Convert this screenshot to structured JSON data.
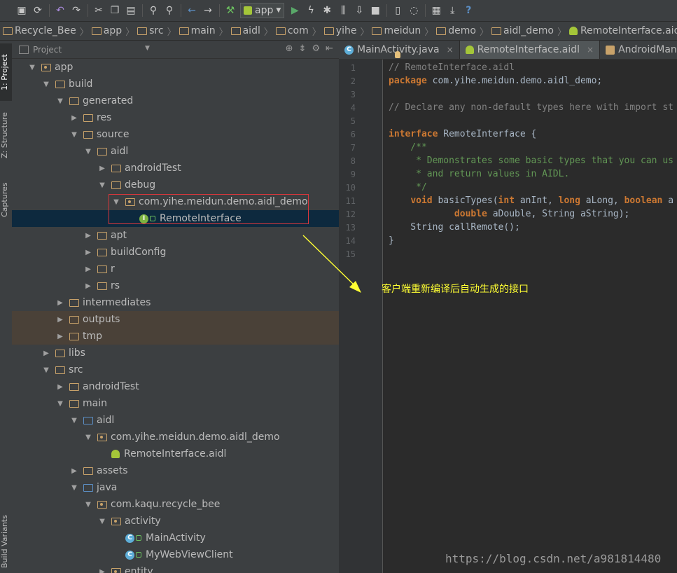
{
  "toolbar": {
    "run_config": "app",
    "icons": [
      "save-icon",
      "sync-icon",
      "undo-icon",
      "redo-icon",
      "cut-icon",
      "copy-icon",
      "paste-icon",
      "find-icon",
      "replace-icon",
      "back-icon",
      "forward-icon",
      "make-icon",
      "run-icon",
      "apply-changes-icon",
      "debug-icon",
      "profile-icon",
      "attach-debugger-icon",
      "stop-icon",
      "avd-manager-icon",
      "gradle-sync-icon",
      "project-structure-icon",
      "sdk-manager-icon",
      "help-icon"
    ]
  },
  "breadcrumb": [
    "Recycle_Bee",
    "app",
    "src",
    "main",
    "aidl",
    "com",
    "yihe",
    "meidun",
    "demo",
    "aidl_demo",
    "RemoteInterface.aidl"
  ],
  "left_stripe": {
    "project_tab": "1: Project",
    "structure_tab": "Z: Structure",
    "captures_tab": "Captures",
    "build_variants_tab": "Build Variants"
  },
  "project_panel": {
    "title": "Project",
    "tree": [
      {
        "label": "app",
        "depth": 1,
        "arrow": "down",
        "icon": "module"
      },
      {
        "label": "build",
        "depth": 2,
        "arrow": "down",
        "icon": "folder"
      },
      {
        "label": "generated",
        "depth": 3,
        "arrow": "down",
        "icon": "folder"
      },
      {
        "label": "res",
        "depth": 4,
        "arrow": "right",
        "icon": "folder"
      },
      {
        "label": "source",
        "depth": 4,
        "arrow": "down",
        "icon": "folder"
      },
      {
        "label": "aidl",
        "depth": 5,
        "arrow": "down",
        "icon": "folder"
      },
      {
        "label": "androidTest",
        "depth": 6,
        "arrow": "right",
        "icon": "folder"
      },
      {
        "label": "debug",
        "depth": 6,
        "arrow": "down",
        "icon": "folder-gear"
      },
      {
        "label": "com.yihe.meidun.demo.aidl_demo",
        "depth": 7,
        "arrow": "down",
        "icon": "package"
      },
      {
        "label": "RemoteInterface",
        "depth": 8,
        "arrow": "none",
        "icon": "interface",
        "selected": true
      },
      {
        "label": "apt",
        "depth": 5,
        "arrow": "right",
        "icon": "folder"
      },
      {
        "label": "buildConfig",
        "depth": 5,
        "arrow": "right",
        "icon": "folder"
      },
      {
        "label": "r",
        "depth": 5,
        "arrow": "right",
        "icon": "folder"
      },
      {
        "label": "rs",
        "depth": 5,
        "arrow": "right",
        "icon": "folder"
      },
      {
        "label": "intermediates",
        "depth": 3,
        "arrow": "right",
        "icon": "folder"
      },
      {
        "label": "outputs",
        "depth": 3,
        "arrow": "right",
        "icon": "folder",
        "tan": true
      },
      {
        "label": "tmp",
        "depth": 3,
        "arrow": "right",
        "icon": "folder",
        "tan": true
      },
      {
        "label": "libs",
        "depth": 2,
        "arrow": "right",
        "icon": "folder"
      },
      {
        "label": "src",
        "depth": 2,
        "arrow": "down",
        "icon": "folder"
      },
      {
        "label": "androidTest",
        "depth": 3,
        "arrow": "right",
        "icon": "folder"
      },
      {
        "label": "main",
        "depth": 3,
        "arrow": "down",
        "icon": "folder"
      },
      {
        "label": "aidl",
        "depth": 4,
        "arrow": "down",
        "icon": "folder-blue"
      },
      {
        "label": "com.yihe.meidun.demo.aidl_demo",
        "depth": 5,
        "arrow": "down",
        "icon": "package"
      },
      {
        "label": "RemoteInterface.aidl",
        "depth": 6,
        "arrow": "none",
        "icon": "android"
      },
      {
        "label": "assets",
        "depth": 4,
        "arrow": "right",
        "icon": "folder-assets"
      },
      {
        "label": "java",
        "depth": 4,
        "arrow": "down",
        "icon": "folder-blue"
      },
      {
        "label": "com.kaqu.recycle_bee",
        "depth": 5,
        "arrow": "down",
        "icon": "package"
      },
      {
        "label": "activity",
        "depth": 6,
        "arrow": "down",
        "icon": "package"
      },
      {
        "label": "MainActivity",
        "depth": 7,
        "arrow": "none",
        "icon": "class"
      },
      {
        "label": "MyWebViewClient",
        "depth": 7,
        "arrow": "none",
        "icon": "class"
      },
      {
        "label": "entity",
        "depth": 6,
        "arrow": "right",
        "icon": "package"
      }
    ]
  },
  "editor": {
    "tabs": [
      {
        "label": "MainActivity.java",
        "icon": "class",
        "active": false
      },
      {
        "label": "RemoteInterface.aidl",
        "icon": "android",
        "active": true
      },
      {
        "label": "AndroidManifest.xml",
        "icon": "manifest",
        "active": false
      }
    ],
    "line_numbers": [
      "1",
      "2",
      "3",
      "4",
      "5",
      "6",
      "7",
      "8",
      "9",
      "10",
      "11",
      "12",
      "13",
      "14",
      "15"
    ],
    "code_lines": [
      [
        {
          "t": "// RemoteInterface.aidl",
          "c": "cm"
        }
      ],
      [
        {
          "t": "package",
          "c": "kw"
        },
        {
          "t": " com.yihe.meidun.demo.aidl_demo;",
          "c": ""
        }
      ],
      [],
      [
        {
          "t": "// Declare any non-default types here with import st",
          "c": "cm"
        }
      ],
      [],
      [
        {
          "t": "interface",
          "c": "kw"
        },
        {
          "t": " RemoteInterface {",
          "c": ""
        }
      ],
      [
        {
          "t": "    /**",
          "c": "dc"
        }
      ],
      [
        {
          "t": "     * Demonstrates some basic types that you can us",
          "c": "dc"
        }
      ],
      [
        {
          "t": "     * and return values in AIDL.",
          "c": "dc"
        }
      ],
      [
        {
          "t": "     */",
          "c": "dc"
        }
      ],
      [
        {
          "t": "    ",
          "c": ""
        },
        {
          "t": "void",
          "c": "kw"
        },
        {
          "t": " basicTypes(",
          "c": ""
        },
        {
          "t": "int",
          "c": "kw"
        },
        {
          "t": " anInt, ",
          "c": ""
        },
        {
          "t": "long",
          "c": "kw"
        },
        {
          "t": " aLong, ",
          "c": ""
        },
        {
          "t": "boolean",
          "c": "kw"
        },
        {
          "t": " a",
          "c": ""
        }
      ],
      [
        {
          "t": "            ",
          "c": ""
        },
        {
          "t": "double",
          "c": "kw"
        },
        {
          "t": " aDouble, String aString);",
          "c": ""
        }
      ],
      [
        {
          "t": "    String callRemote();",
          "c": ""
        }
      ],
      [
        {
          "t": "}",
          "c": ""
        }
      ],
      []
    ]
  },
  "annotation": "客户端重新编译后自动生成的接口",
  "watermark": "https://blog.csdn.net/a981814480",
  "colors": {
    "annotation": "#ffff33",
    "highlight_box": "#d9373c",
    "selection": "#0d293e"
  }
}
